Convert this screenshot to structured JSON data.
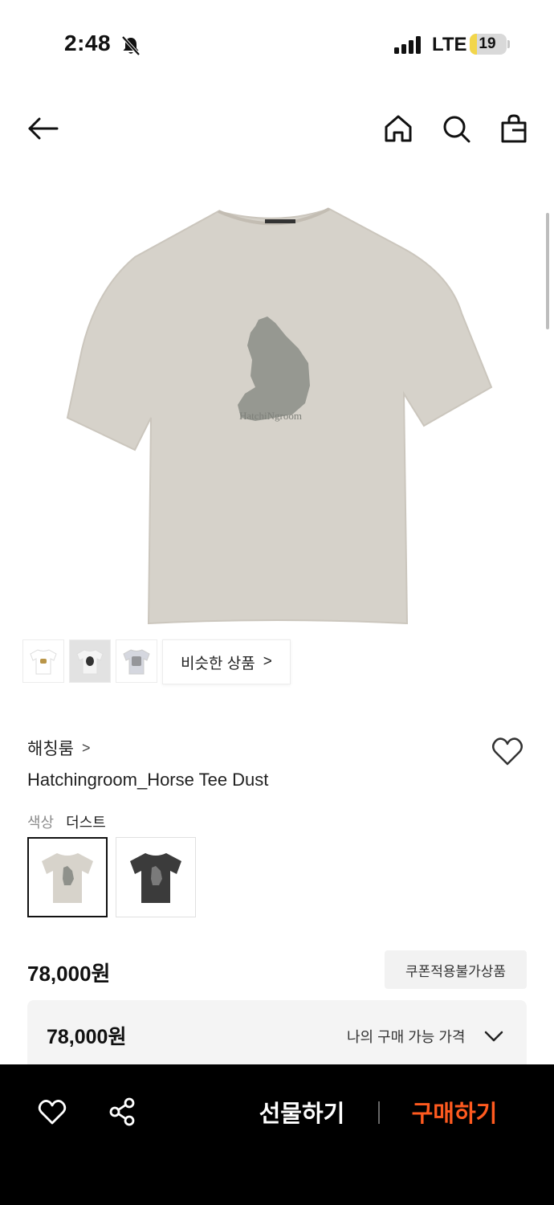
{
  "status_bar": {
    "time": "2:48",
    "network": "LTE",
    "battery_percent": "19",
    "battery_color": "#f2d64b"
  },
  "header": {
    "back_icon": "arrow-left",
    "home_icon": "home",
    "search_icon": "search",
    "bag_icon": "shopping-bag"
  },
  "hero": {
    "shirt_color": "#d6d2ca",
    "print_color": "#8f918b",
    "print_text": "HatchiNgroom"
  },
  "thumbnails": {
    "items": [
      {
        "bg": "#ffffff",
        "shirt": "#ffffff",
        "print": "#b99548"
      },
      {
        "bg": "#e2e2e2",
        "shirt": "#f4f4f4",
        "print": "#333333"
      },
      {
        "bg": "#ffffff",
        "shirt": "#d5d7df",
        "print": "#555555"
      }
    ],
    "similar_label": "비슷한 상품",
    "similar_chevron": ">"
  },
  "product": {
    "brand": "해칭룸",
    "brand_chevron": ">",
    "name": "Hatchingroom_Horse Tee Dust",
    "color_label": "색상",
    "color_value": "더스트",
    "swatches": [
      {
        "shirt": "#d7d3cb",
        "print": "#8f918b",
        "selected": true
      },
      {
        "shirt": "#3b3b3b",
        "print": "#7a7a7a",
        "selected": false
      }
    ],
    "price": "78,000원",
    "coupon_badge": "쿠폰적용불가상품",
    "my_price_value": "78,000원",
    "my_price_label": "나의 구매 가능 가격"
  },
  "bottom_bar": {
    "gift_label": "선물하기",
    "buy_label": "구매하기",
    "buy_color": "#ff5a1f"
  }
}
